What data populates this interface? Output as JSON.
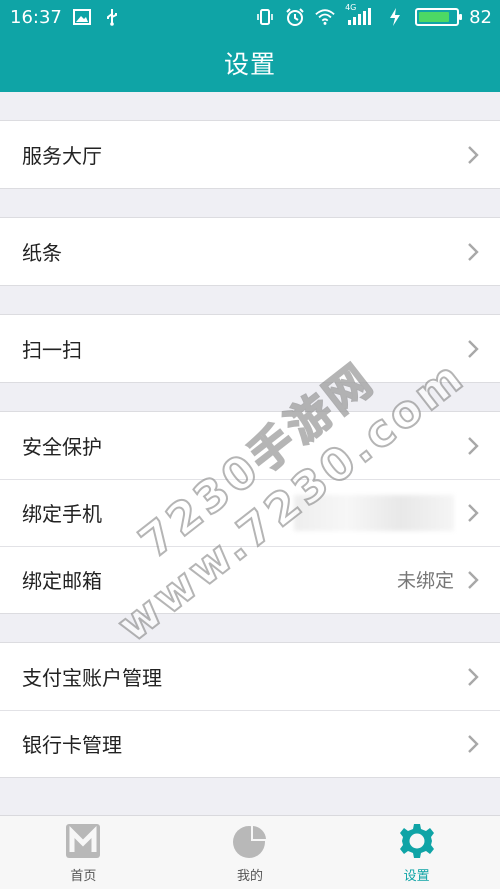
{
  "status_bar": {
    "time": "16:37",
    "battery": "82",
    "battery_level": 0.82,
    "network": "4G",
    "icons_left": [
      "image-icon",
      "usb-icon"
    ],
    "icons_right": [
      "vibrate-icon",
      "alarm-icon",
      "wifi-icon",
      "signal-icon",
      "charging-icon",
      "battery-icon"
    ]
  },
  "header": {
    "title": "设置"
  },
  "groups": [
    {
      "items": [
        {
          "label": "服务大厅",
          "value": ""
        }
      ]
    },
    {
      "items": [
        {
          "label": "纸条",
          "value": ""
        }
      ]
    },
    {
      "items": [
        {
          "label": "扫一扫",
          "value": ""
        }
      ]
    },
    {
      "items": [
        {
          "label": "安全保护",
          "value": ""
        },
        {
          "label": "绑定手机",
          "value": ""
        },
        {
          "label": "绑定邮箱",
          "value": "未绑定"
        }
      ]
    },
    {
      "items": [
        {
          "label": "支付宝账户管理",
          "value": ""
        },
        {
          "label": "银行卡管理",
          "value": ""
        }
      ]
    }
  ],
  "tabs": [
    {
      "label": "首页",
      "icon": "home-m-icon",
      "active": false
    },
    {
      "label": "我的",
      "icon": "pie-chart-icon",
      "active": false
    },
    {
      "label": "设置",
      "icon": "gear-icon",
      "active": true
    }
  ],
  "watermark": {
    "line1": "7230手游网",
    "line2": "www.7230.com"
  },
  "colors": {
    "accent": "#0fa4a6",
    "background": "#efeff4",
    "row_bg": "#ffffff",
    "tab_inactive": "#b8b8b8"
  }
}
